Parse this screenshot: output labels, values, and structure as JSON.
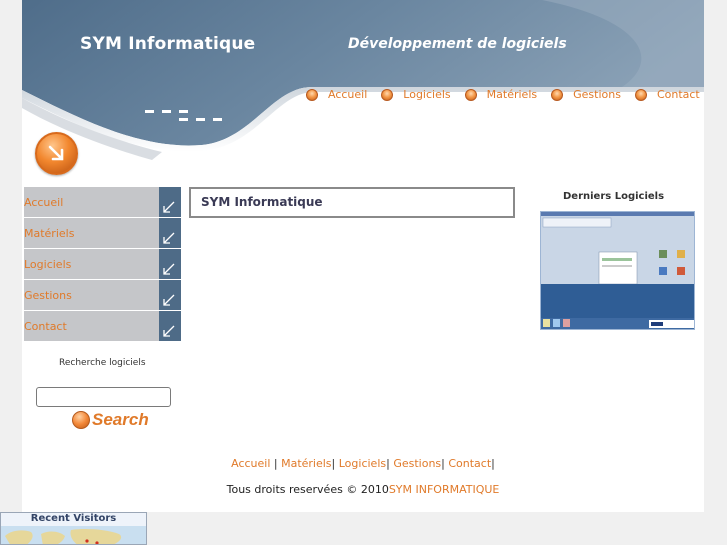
{
  "header": {
    "brand": "SYM Informatique",
    "tagline": "Développement de logiciels",
    "nav": [
      {
        "label": "Accueil"
      },
      {
        "label": "Logiciels"
      },
      {
        "label": "Matériels"
      },
      {
        "label": "Gestions"
      },
      {
        "label": "Contact"
      }
    ]
  },
  "sidebar": {
    "items": [
      {
        "label": "Accueil"
      },
      {
        "label": "Matériels"
      },
      {
        "label": "Logiciels"
      },
      {
        "label": "Gestions"
      },
      {
        "label": "Contact"
      }
    ],
    "search": {
      "label": "Recherche logiciels",
      "value": "",
      "button": "Search"
    }
  },
  "main": {
    "title": "SYM Informatique"
  },
  "right": {
    "title": "Derniers Logiciels"
  },
  "footer": {
    "links": [
      "Accueil",
      "Matériels",
      "Logiciels",
      "Gestions",
      "Contact"
    ],
    "copyright_prefix": "Tous droits reservées © 2010",
    "copyright_org": "SYM INFORMATIQUE"
  },
  "widget": {
    "title": "Recent Visitors"
  },
  "colors": {
    "accent": "#e07a2a",
    "header_blue": "#5b7893",
    "menu_grey": "#c5c6c9",
    "menu_tab": "#4e6b87"
  },
  "icons": {
    "nav_bullet": "orange-ball-icon",
    "menu_arrow": "arrow-down-left-icon",
    "header_button": "arrow-down-right-icon",
    "search": "orange-ball-icon"
  }
}
